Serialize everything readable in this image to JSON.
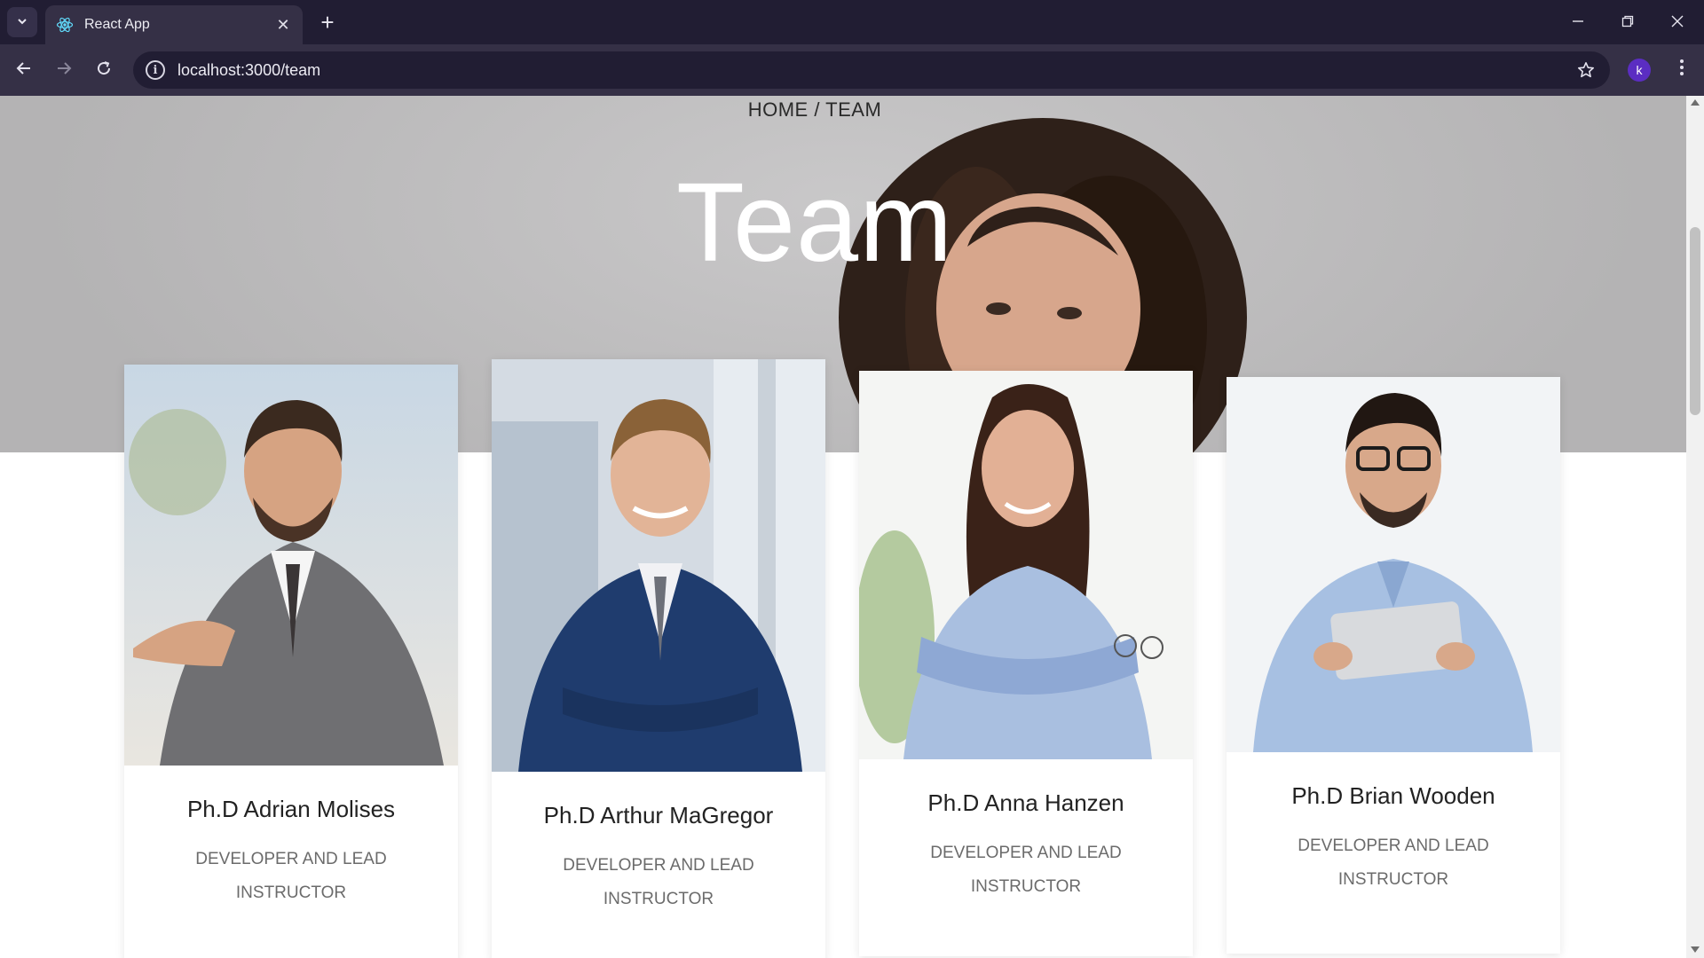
{
  "browser": {
    "tab_title": "React App",
    "url": "localhost:3000/team",
    "profile_initial": "k",
    "icons": {
      "tab_search": "chevron-down-icon",
      "favicon": "react-icon",
      "tab_close": "close-icon",
      "new_tab": "plus-icon",
      "minimize": "minimize-icon",
      "restore": "restore-icon",
      "close_window": "close-icon",
      "back": "arrow-left-icon",
      "forward": "arrow-right-icon",
      "reload": "reload-icon",
      "site_info": "info-icon",
      "bookmark": "star-icon",
      "menu": "kebab-menu-icon"
    }
  },
  "page": {
    "breadcrumb": "HOME / TEAM",
    "title": "Team",
    "team": [
      {
        "name": "Ph.D Adrian Molises",
        "role": "DEVELOPER AND LEAD INSTRUCTOR"
      },
      {
        "name": "Ph.D Arthur MaGregor",
        "role": "DEVELOPER AND LEAD INSTRUCTOR"
      },
      {
        "name": "Ph.D Anna Hanzen",
        "role": "DEVELOPER AND LEAD INSTRUCTOR"
      },
      {
        "name": "Ph.D Brian Wooden",
        "role": "DEVELOPER AND LEAD INSTRUCTOR"
      }
    ]
  },
  "colors": {
    "chrome_dark": "#211d33",
    "chrome_toolbar": "#353046",
    "avatar": "#5b2dc2",
    "hero_gray": "#c0bfc0",
    "title_white": "#ffffff"
  }
}
